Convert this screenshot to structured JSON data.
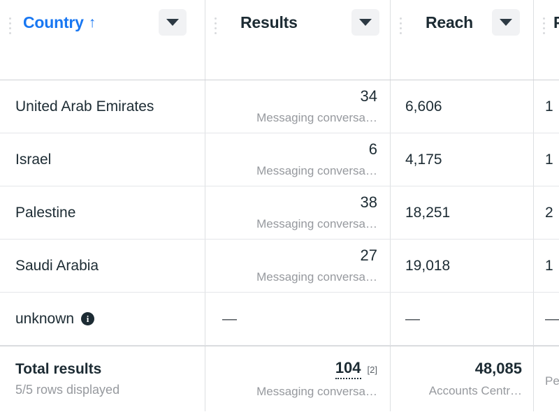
{
  "table": {
    "columns": [
      {
        "key": "country",
        "label": "Country",
        "sorted": true,
        "sort_arrow": "↑",
        "accent_color": "#1877f2",
        "has_menu": true
      },
      {
        "key": "results",
        "label": "Results",
        "sorted": false,
        "has_menu": true
      },
      {
        "key": "reach",
        "label": "Reach",
        "sorted": false,
        "has_menu": true
      },
      {
        "key": "fourth",
        "label": "P",
        "sorted": false,
        "has_menu": false,
        "truncated": true
      }
    ],
    "rows": [
      {
        "country": "United Arab Emirates",
        "has_info_icon": false,
        "results_value": "34",
        "results_caption": "Messaging conversa…",
        "reach": "6,606",
        "fourth": "1"
      },
      {
        "country": "Israel",
        "has_info_icon": false,
        "results_value": "6",
        "results_caption": "Messaging conversa…",
        "reach": "4,175",
        "fourth": "1"
      },
      {
        "country": "Palestine",
        "has_info_icon": false,
        "results_value": "38",
        "results_caption": "Messaging conversa…",
        "reach": "18,251",
        "fourth": "2"
      },
      {
        "country": "Saudi Arabia",
        "has_info_icon": false,
        "results_value": "27",
        "results_caption": "Messaging conversa…",
        "reach": "19,018",
        "fourth": "1"
      },
      {
        "country": "unknown",
        "has_info_icon": true,
        "info_icon_glyph": "i",
        "results_value": "—",
        "results_caption": "",
        "reach": "—",
        "fourth": "—"
      }
    ],
    "footer": {
      "title": "Total results",
      "subtitle": "5/5 rows displayed",
      "results_value": "104",
      "results_footnote": "[2]",
      "results_caption": "Messaging conversa…",
      "reach_value": "48,085",
      "reach_caption": "Accounts Centr…",
      "fourth_caption": "Pe"
    }
  },
  "icons": {
    "drag_handle": "drag-handle-icon",
    "caret_down": "chevron-down-icon",
    "info": "info-icon",
    "sort_ascending": "sort-ascending-icon"
  }
}
